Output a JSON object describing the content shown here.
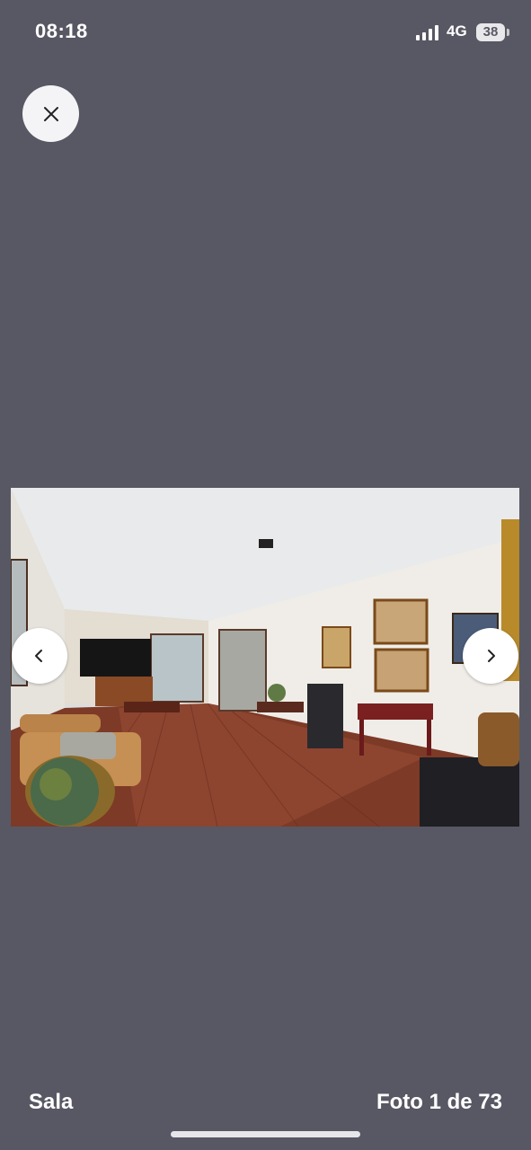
{
  "status_bar": {
    "time": "08:18",
    "network": "4G",
    "battery": "38"
  },
  "icons": {
    "close": "close-icon",
    "prev": "chevron-left-icon",
    "next": "chevron-right-icon"
  },
  "photo": {
    "caption": "Sala",
    "counter": "Foto 1 de 73"
  },
  "colors": {
    "background": "#585864",
    "button": "#f4f4f6"
  }
}
